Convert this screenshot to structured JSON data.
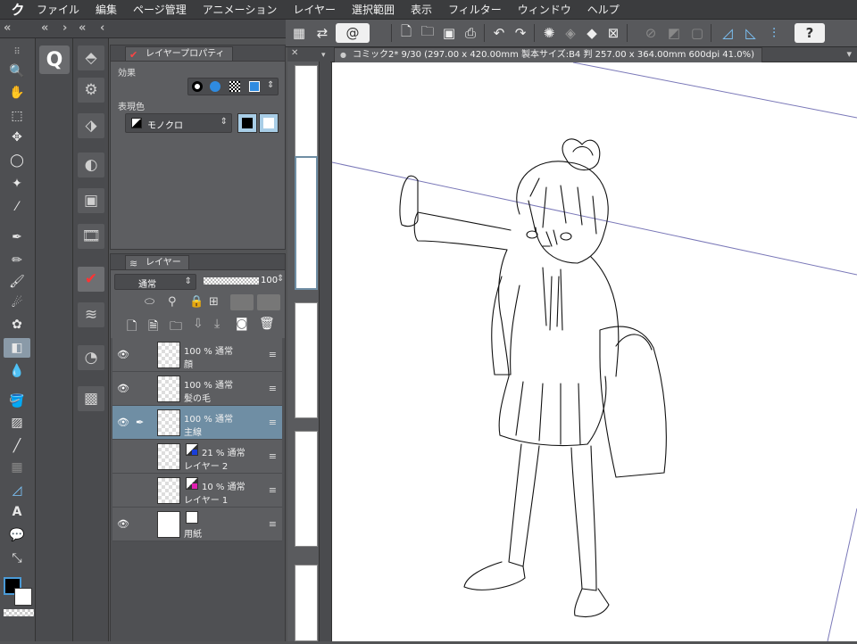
{
  "menu": {
    "logo": "ク",
    "items": [
      "ファイル",
      "編集",
      "ページ管理",
      "アニメーション",
      "レイヤー",
      "選択範囲",
      "表示",
      "フィルター",
      "ウィンドウ",
      "ヘルプ"
    ]
  },
  "canvas_tab": {
    "title": "コミック2* 9/30 (297.00 x 420.00mm 製本サイズ:B4 判 257.00 x 364.00mm 600dpi 41.0%)"
  },
  "layer_property": {
    "tab_label": "レイヤープロパティ",
    "effect_label": "効果",
    "color_label": "表現色",
    "color_mode": "モノクロ"
  },
  "layer_panel": {
    "tab_label": "レイヤー",
    "blend_mode": "通常",
    "opacity": "100",
    "layers": [
      {
        "mode": "100 % 通常",
        "name": "顔",
        "visible": true,
        "selected": false
      },
      {
        "mode": "100 % 通常",
        "name": "髪の毛",
        "visible": true,
        "selected": false
      },
      {
        "mode": "100 % 通常",
        "name": "主線",
        "visible": true,
        "selected": true
      },
      {
        "mode": "21 % 通常",
        "name": "レイヤー 2",
        "visible": false,
        "selected": false
      },
      {
        "mode": "10 % 通常",
        "name": "レイヤー 1",
        "visible": false,
        "selected": false
      },
      {
        "mode": "",
        "name": "用紙",
        "visible": true,
        "selected": false
      }
    ]
  },
  "colors": {
    "selected_layer": "#6f8ea4",
    "menubar_bg": "#3b3c3e",
    "panel_bg": "#5d5e61",
    "accent_blue": "#2f8be0"
  }
}
